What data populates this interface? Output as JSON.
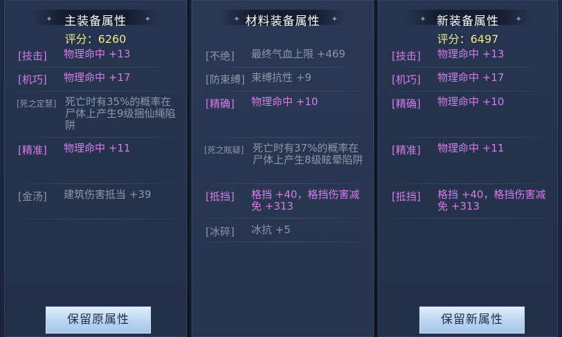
{
  "left_panel": {
    "title": "主装备属性",
    "score": "评分：6260",
    "rows": [
      {
        "tag": "[技击]",
        "value": "物理命中 +13"
      },
      {
        "tag": "[机巧]",
        "value": "物理命中 +17"
      },
      {
        "tag": "[死之定慧]",
        "value": "死亡时有35%的概率在尸体上产生9级捆仙绳陷阱"
      },
      {
        "tag": "[精准]",
        "value": "物理命中 +11"
      },
      {
        "tag": "[金汤]",
        "value": "建筑伤害抵当 +39"
      }
    ],
    "button": "保留原属性"
  },
  "mid_panel": {
    "title": "材料装备属性",
    "rows": [
      {
        "tag": "[不绝]",
        "value": "最终气血上限 +469"
      },
      {
        "tag": "[防束缚]",
        "value": "束缚抗性 +9"
      },
      {
        "tag": "[精确]",
        "value": "物理命中 +10"
      },
      {
        "tag": "[死之眩疑]",
        "value": "死亡时有37%的概率在尸体上产生8级眩晕陷阱"
      },
      {
        "tag": "[抵挡]",
        "value": "格挡 +40，格挡伤害减免 +313"
      },
      {
        "tag": "[冰碎]",
        "value": "冰抗 +5"
      }
    ]
  },
  "right_panel": {
    "title": "新装备属性",
    "score": "评分：6497",
    "rows": [
      {
        "tag": "[技击]",
        "value": "物理命中 +13"
      },
      {
        "tag": "[机巧]",
        "value": "物理命中 +17"
      },
      {
        "tag": "[精确]",
        "value": "物理命中 +10"
      },
      {
        "tag": "[精准]",
        "value": "物理命中 +11"
      },
      {
        "tag": "[抵挡]",
        "value": "格挡 +40，格挡伤害减免 +313"
      }
    ],
    "button": "保留新属性"
  },
  "colors": {
    "attr_active": "#d77ce9",
    "attr_inactive": "#8d97a8",
    "score": "#ecea8a",
    "title": "#ffffff"
  }
}
